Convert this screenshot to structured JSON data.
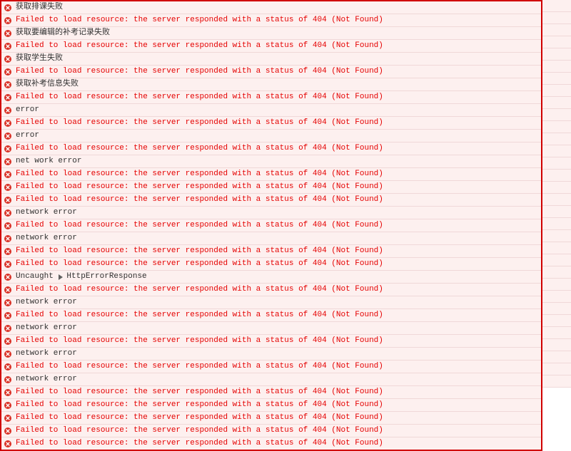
{
  "messages": {
    "failed404": "Failed to load resource: the server responded with a status of 404 (Not Found)",
    "err_paike": "获取排课失败",
    "err_bukao_edit": "获取要编辑的补考记录失败",
    "err_student": "获取学生失败",
    "err_bukao_info": "获取补考信息失败",
    "error": "error",
    "net_work_error": "net work error",
    "network_error": "network error",
    "uncaught": "Uncaught",
    "http_error_response": "HttpErrorResponse"
  },
  "rows": [
    {
      "type": "log",
      "bind": "messages.err_paike"
    },
    {
      "type": "err",
      "bind": "messages.failed404"
    },
    {
      "type": "log",
      "bind": "messages.err_bukao_edit"
    },
    {
      "type": "err",
      "bind": "messages.failed404"
    },
    {
      "type": "log",
      "bind": "messages.err_student"
    },
    {
      "type": "err",
      "bind": "messages.failed404"
    },
    {
      "type": "log",
      "bind": "messages.err_bukao_info"
    },
    {
      "type": "err",
      "bind": "messages.failed404"
    },
    {
      "type": "log",
      "bind": "messages.error"
    },
    {
      "type": "err",
      "bind": "messages.failed404"
    },
    {
      "type": "log",
      "bind": "messages.error"
    },
    {
      "type": "err",
      "bind": "messages.failed404"
    },
    {
      "type": "log",
      "bind": "messages.net_work_error"
    },
    {
      "type": "err",
      "bind": "messages.failed404"
    },
    {
      "type": "err",
      "bind": "messages.failed404"
    },
    {
      "type": "err",
      "bind": "messages.failed404"
    },
    {
      "type": "log",
      "bind": "messages.network_error"
    },
    {
      "type": "err",
      "bind": "messages.failed404"
    },
    {
      "type": "log",
      "bind": "messages.network_error"
    },
    {
      "type": "err",
      "bind": "messages.failed404"
    },
    {
      "type": "err",
      "bind": "messages.failed404"
    },
    {
      "type": "uncaught"
    },
    {
      "type": "err",
      "bind": "messages.failed404"
    },
    {
      "type": "log",
      "bind": "messages.network_error"
    },
    {
      "type": "err",
      "bind": "messages.failed404"
    },
    {
      "type": "log",
      "bind": "messages.network_error"
    },
    {
      "type": "err",
      "bind": "messages.failed404"
    },
    {
      "type": "log",
      "bind": "messages.network_error"
    },
    {
      "type": "err",
      "bind": "messages.failed404"
    },
    {
      "type": "log",
      "bind": "messages.network_error"
    },
    {
      "type": "err",
      "bind": "messages.failed404"
    },
    {
      "type": "err",
      "bind": "messages.failed404"
    },
    {
      "type": "err",
      "bind": "messages.failed404"
    },
    {
      "type": "err",
      "bind": "messages.failed404"
    },
    {
      "type": "err-cut",
      "bind": "messages.failed404"
    }
  ]
}
